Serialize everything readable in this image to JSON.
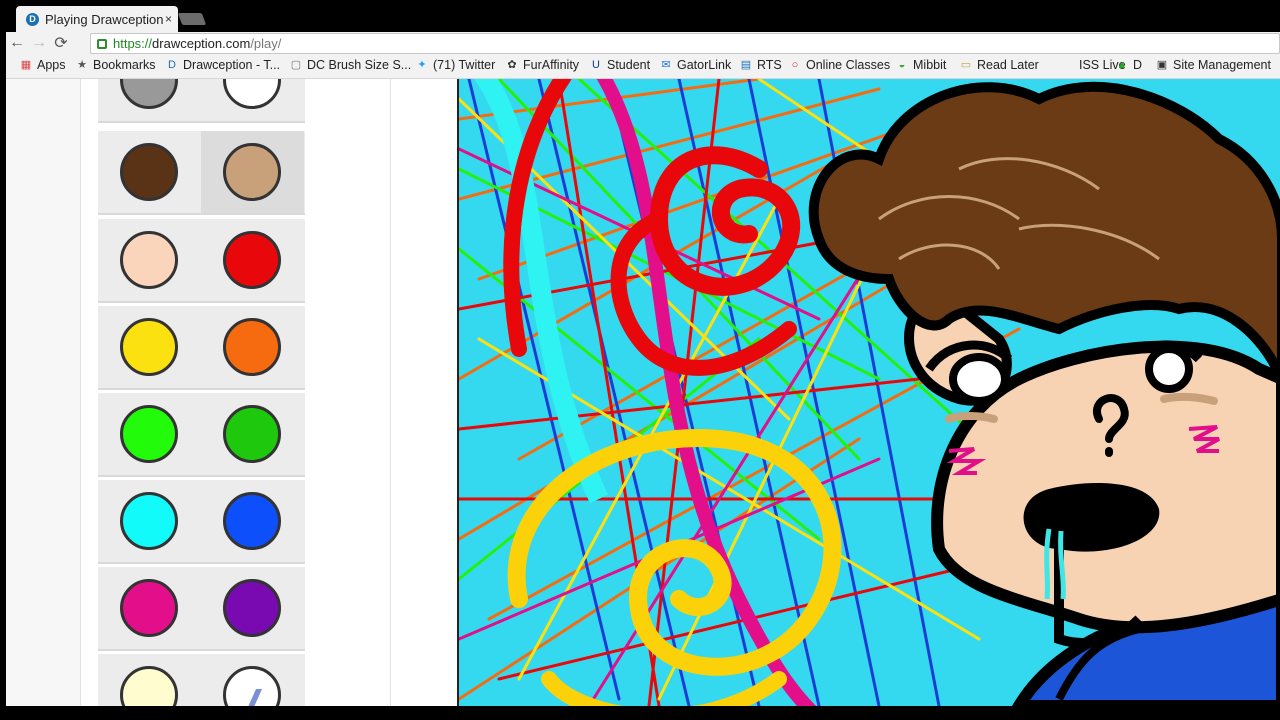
{
  "tab": {
    "title": "Playing Drawception",
    "close": "×",
    "favicon": "D"
  },
  "nav": {
    "back": "←",
    "forward": "→",
    "reload": "⟳"
  },
  "address": {
    "protocol": "https://",
    "host": "drawception.com",
    "path": "/play/"
  },
  "bookmarks": [
    {
      "label": "Apps",
      "icon": "apps-icon"
    },
    {
      "label": "Bookmarks",
      "icon": "star-icon"
    },
    {
      "label": "Drawception - T...",
      "icon": "drawception-icon"
    },
    {
      "label": "DC Brush Size S...",
      "icon": "page-icon"
    },
    {
      "label": "(71) Twitter",
      "icon": "twitter-icon"
    },
    {
      "label": "FurAffinity",
      "icon": "paw-icon"
    },
    {
      "label": "Student",
      "icon": "uf-icon"
    },
    {
      "label": "GatorLink",
      "icon": "mail-icon"
    },
    {
      "label": "RTS",
      "icon": "bus-icon"
    },
    {
      "label": "Online Classes",
      "icon": "ring-icon"
    },
    {
      "label": "Mibbit",
      "icon": "mibbit-icon"
    },
    {
      "label": "Read Later",
      "icon": "folder-icon"
    },
    {
      "label": "ISS Live",
      "icon": "iss-icon"
    },
    {
      "label": "D",
      "icon": "d-icon"
    },
    {
      "label": "Site Management",
      "icon": "lock-icon"
    }
  ],
  "palette": [
    [
      "#999999",
      "#ffffff"
    ],
    [
      "#5a3215",
      "#c8a07a"
    ],
    [
      "#fbd5bb",
      "#e8070a"
    ],
    [
      "#fbe10f",
      "#f66b0f"
    ],
    [
      "#22fb0a",
      "#1ec90d"
    ],
    [
      "#11fbfb",
      "#0d4ffb"
    ],
    [
      "#e20e8a",
      "#790ab2"
    ],
    [
      "#fffcd0",
      "#ffffff"
    ]
  ],
  "palette_selected": {
    "row": 1,
    "col": 1
  }
}
